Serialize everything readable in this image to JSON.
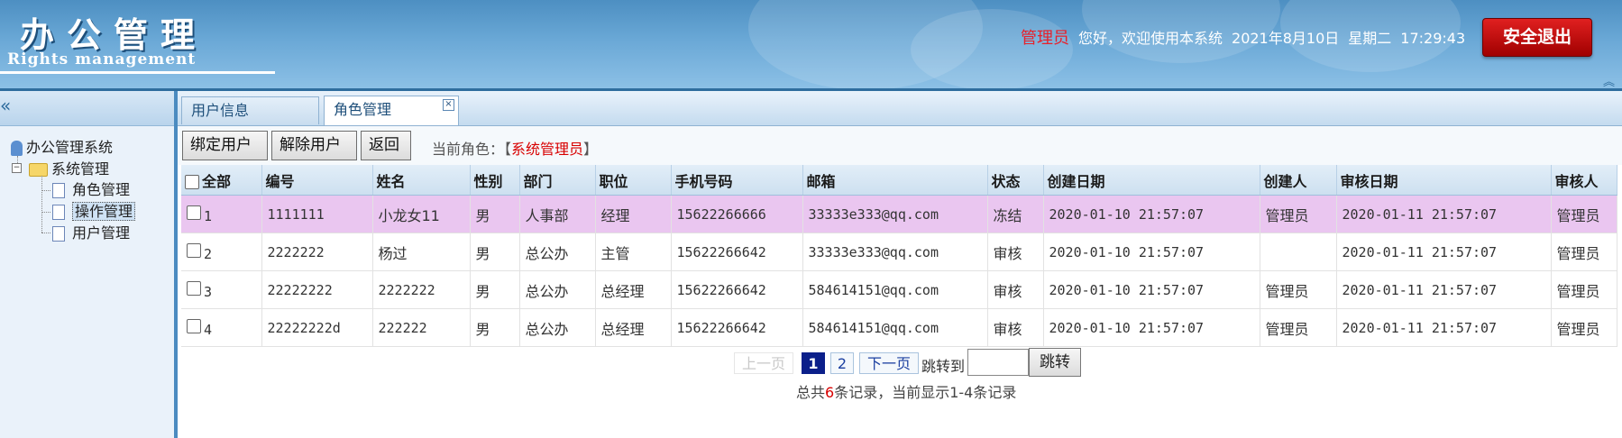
{
  "header": {
    "app_title": "办公管理",
    "app_subtitle": "Rights management",
    "role": "管理员",
    "greeting": "您好，欢迎使用本系统",
    "date": "2021年8月10日",
    "weekday": "星期二",
    "time": "17:29:43",
    "logout_label": "安全退出"
  },
  "sidebar": {
    "root": "办公管理系统",
    "group": "系统管理",
    "items": [
      {
        "label": "角色管理"
      },
      {
        "label": "操作管理"
      },
      {
        "label": "用户管理"
      }
    ]
  },
  "tabs": [
    {
      "label": "用户信息"
    },
    {
      "label": "角色管理",
      "close": "×"
    }
  ],
  "toolbar": {
    "bind_label": "绑定用户",
    "unbind_label": "解除用户",
    "back_label": "返回",
    "current_role_prefix": "当前角色：【",
    "current_role": "系统管理员",
    "current_role_suffix": "】"
  },
  "table": {
    "select_all": "全部",
    "headers": [
      "编号",
      "姓名",
      "性别",
      "部门",
      "职位",
      "手机号码",
      "邮箱",
      "状态",
      "创建日期",
      "创建人",
      "审核日期",
      "审核人"
    ],
    "rows": [
      [
        "1",
        "1111111",
        "小龙女11",
        "男",
        "人事部",
        "经理",
        "15622266666",
        "33333e333@qq.com",
        "冻结",
        "2020-01-10 21:57:07",
        "管理员",
        "2020-01-11 21:57:07",
        "管理员"
      ],
      [
        "2",
        "2222222",
        "杨过",
        "男",
        "总公办",
        "主管",
        "15622266642",
        "33333e333@qq.com",
        "审核",
        "2020-01-10 21:57:07",
        "",
        "2020-01-11 21:57:07",
        "管理员"
      ],
      [
        "3",
        "22222222",
        "2222222",
        "男",
        "总公办",
        "总经理",
        "15622266642",
        "584614151@qq.com",
        "审核",
        "2020-01-10 21:57:07",
        "管理员",
        "2020-01-11 21:57:07",
        "管理员"
      ],
      [
        "4",
        "22222222d",
        "222222",
        "男",
        "总公办",
        "总经理",
        "15622266642",
        "584614151@qq.com",
        "审核",
        "2020-01-10 21:57:07",
        "管理员",
        "2020-01-11 21:57:07",
        "管理员"
      ]
    ]
  },
  "pager": {
    "prev": "上一页",
    "pages": [
      "1",
      "2"
    ],
    "current": "1",
    "next": "下一页",
    "jump_to": "跳转到",
    "jump_value": "",
    "jump_button": "跳转",
    "summary_prefix": "总共",
    "total": "6",
    "summary_suffix": "条记录，当前显示1-4条记录"
  },
  "colors": {
    "accent": "#4b8bc0",
    "selected_row": "#eac6f0",
    "logout": "#c00000",
    "highlight_text": "#d80000"
  }
}
